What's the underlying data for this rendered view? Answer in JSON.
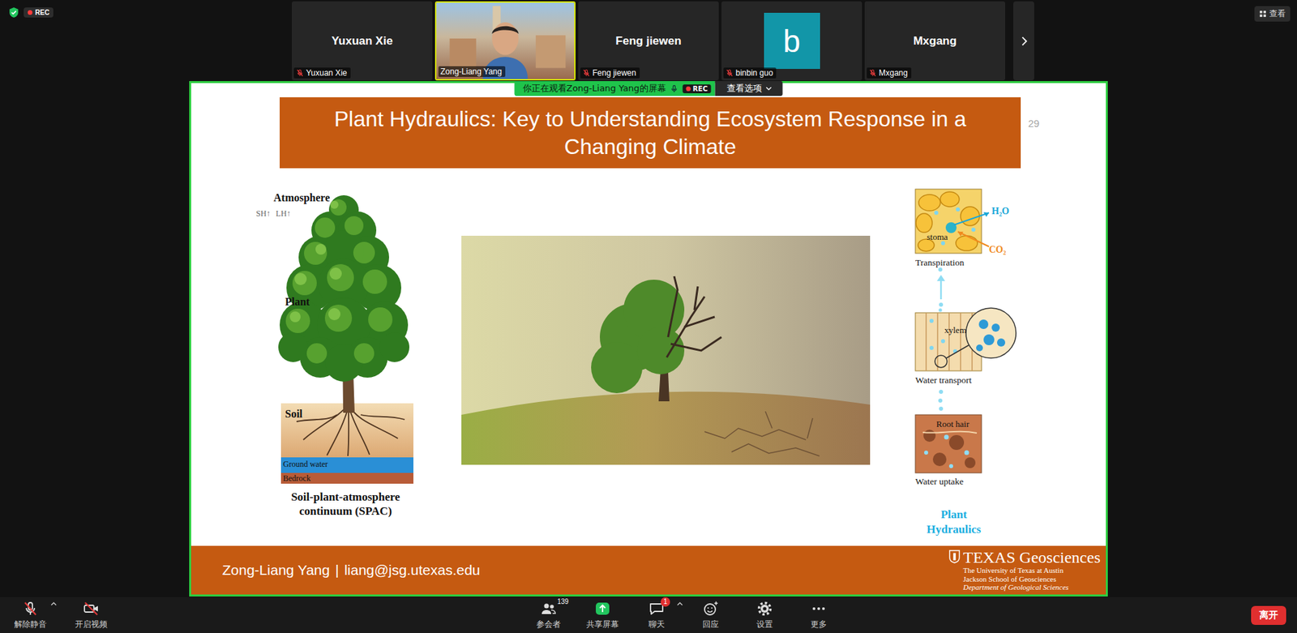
{
  "top_bar": {
    "rec_badge": "REC",
    "view_button": "查看"
  },
  "participants": [
    {
      "name": "Yuxuan Xie",
      "kind": "name",
      "muted": true,
      "active_speaker": false
    },
    {
      "name": "Zong-Liang Yang",
      "kind": "video",
      "muted": false,
      "active_speaker": true
    },
    {
      "name": "Feng jiewen",
      "kind": "name",
      "muted": true,
      "active_speaker": false
    },
    {
      "name": "binbin guo",
      "kind": "avatar",
      "avatar": "b",
      "color": "#1296a8",
      "muted": true,
      "active_speaker": false
    },
    {
      "name": "Mxgang",
      "kind": "name",
      "muted": true,
      "active_speaker": false
    }
  ],
  "share_banner": {
    "text": "你正在观看Zong-Liang Yang的屏幕",
    "rec": "REC",
    "options": "查看选项"
  },
  "slide": {
    "title": "Plant Hydraulics: Key to Understanding Ecosystem Response in a Changing Climate",
    "page": "29",
    "spac": {
      "atmosphere": "Atmosphere",
      "sh": "SH↑",
      "lh": "LH↑",
      "plant": "Plant",
      "soil": "Soil",
      "groundwater": "Ground water",
      "bedrock": "Bedrock",
      "caption_lines": [
        "Soil-plant-atmosphere",
        "continuum (SPAC)"
      ]
    },
    "hydraulics": {
      "stages": [
        {
          "label": "Transpiration",
          "inner": "stoma"
        },
        {
          "label": "Water transport",
          "inner": "xylem"
        },
        {
          "label": "Water uptake",
          "inner": "Root hair"
        }
      ],
      "h2o": "H₂O",
      "co2": "CO₂",
      "title_lines": [
        "Plant",
        "Hydraulics"
      ]
    },
    "footer": {
      "name": "Zong-Liang Yang",
      "separator": "|",
      "email": "liang@jsg.utexas.edu",
      "logo": {
        "brand": "TEXAS Geosciences",
        "lines": [
          "The University of Texas at Austin",
          "Jackson School of Geosciences",
          "Department of Geological Sciences"
        ]
      }
    }
  },
  "toolbar": {
    "items": [
      {
        "label": "解除静音",
        "kind": "mic",
        "off": true,
        "has_menu": true
      },
      {
        "label": "开启视频",
        "kind": "video",
        "off": true,
        "has_menu": false
      },
      {
        "label": "参会者",
        "kind": "participants",
        "count": "139",
        "off": false,
        "has_menu": false
      },
      {
        "label": "共享屏幕",
        "kind": "share",
        "off": false,
        "has_menu": false
      },
      {
        "label": "聊天",
        "kind": "chat",
        "badge": "1",
        "off": false,
        "has_menu": true
      },
      {
        "label": "回应",
        "kind": "reaction",
        "off": false,
        "has_menu": false
      },
      {
        "label": "设置",
        "kind": "settings",
        "off": false,
        "has_menu": false
      },
      {
        "label": "更多",
        "kind": "more",
        "off": false,
        "has_menu": false
      }
    ],
    "leave": "离开"
  }
}
